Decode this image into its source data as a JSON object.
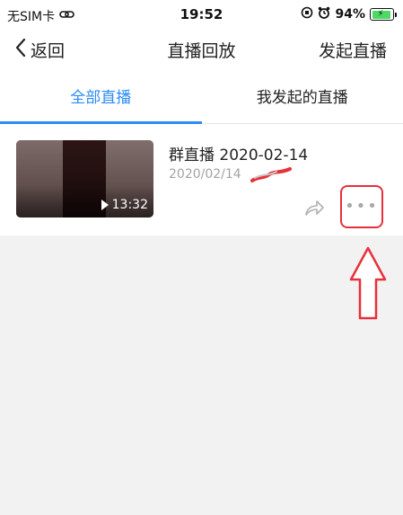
{
  "status_bar": {
    "carrier": "无SIM卡",
    "time": "19:52",
    "battery": "94%"
  },
  "nav": {
    "back_label": "返回",
    "title": "直播回放",
    "action_label": "发起直播"
  },
  "tabs": [
    {
      "label": "全部直播",
      "active": true
    },
    {
      "label": "我发起的直播",
      "active": false
    }
  ],
  "item": {
    "title": "群直播 2020-02-14",
    "date": "2020/02/14",
    "duration": "13:32",
    "more_label": "•••"
  },
  "colors": {
    "accent": "#2c8cf4",
    "annotation_red": "#e8303a",
    "battery_green": "#4cd964"
  }
}
